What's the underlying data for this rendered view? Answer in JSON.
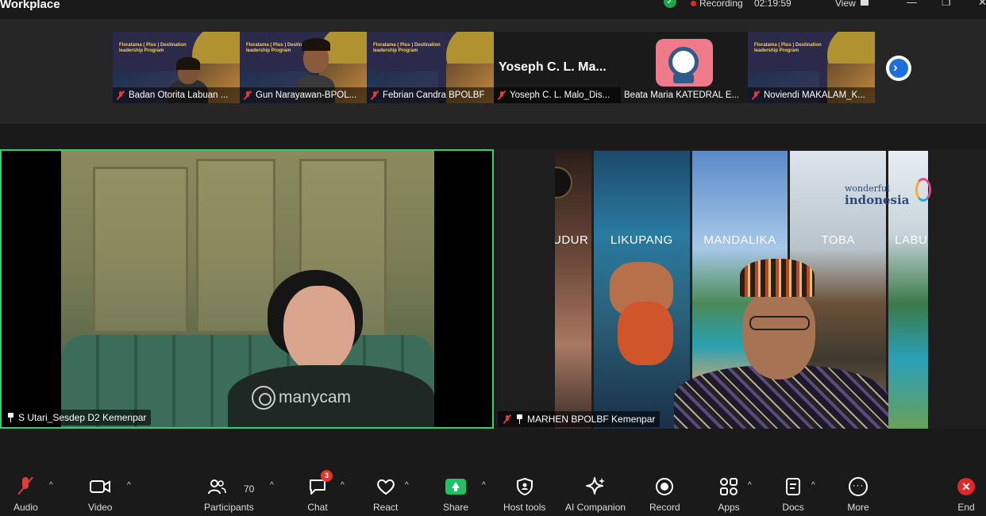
{
  "window": {
    "title": "Workplace",
    "recording_label": "Recording",
    "timer": "02:19:59",
    "view_label": "View"
  },
  "gallery": {
    "thumbnails": [
      {
        "name": "Badan Otorita Labuan ...",
        "kind": "slide",
        "slide_text": "Floratama ( Plus ) Destination leadership Program",
        "has_person": true
      },
      {
        "name": "Gun Narayawan-BPOL...",
        "kind": "slide",
        "slide_text": "Floratama ( Plus ) Destination leadership Program",
        "has_person": true
      },
      {
        "name": "Febrian Candra BPOLBF",
        "kind": "slide",
        "slide_text": "Floratama ( Plus ) Destination leadership Program",
        "has_person": false
      },
      {
        "name": "Yoseph C. L. Malo_Dis...",
        "kind": "namecard",
        "display_name": "Yoseph C. L. Ma..."
      },
      {
        "name": "Beata Maria KATEDRAL E...",
        "kind": "icon"
      },
      {
        "name": "Noviendi MAKALAM_K...",
        "kind": "slide",
        "slide_text": "Floratama ( Plus ) Destination leadership Program",
        "has_person": false
      }
    ],
    "next_icon": "chevron-right-icon"
  },
  "main_tiles": {
    "left": {
      "name": "S Utari_Sesdep D2 Kemenpar",
      "watermark": "manycam",
      "active_speaker_color": "#2bd46c"
    },
    "right": {
      "name": "MARHEN BPOLBF Kemenpar",
      "slide_columns": [
        "DUDUR",
        "LIKUPANG",
        "MANDALIKA",
        "TOBA",
        "LABU"
      ],
      "brand_small": "wonderful",
      "brand_big": "indonesia"
    }
  },
  "toolbar": {
    "audio": "Audio",
    "video": "Video",
    "participants": "Participants",
    "participants_count": "70",
    "chat": "Chat",
    "chat_badge": "3",
    "react": "React",
    "share": "Share",
    "host_tools": "Host tools",
    "ai_companion": "AI Companion",
    "record": "Record",
    "apps": "Apps",
    "docs": "Docs",
    "more": "More",
    "end": "End"
  },
  "colors": {
    "background": "#1a1a1a",
    "share_green": "#1fc266",
    "end_red": "#e02828",
    "mute_red": "#e03b3b",
    "next_blue": "#1d6fe0"
  }
}
